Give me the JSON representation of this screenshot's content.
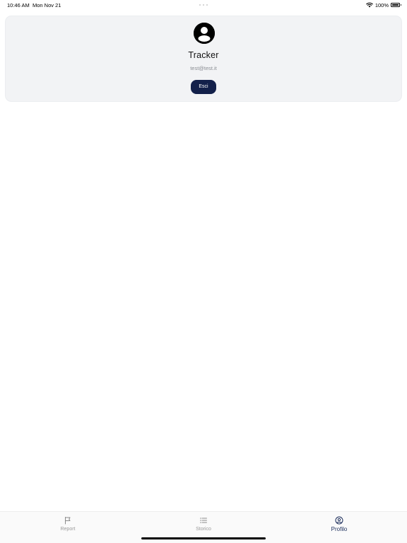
{
  "status_bar": {
    "time": "10:46 AM",
    "date": "Mon Nov 21",
    "battery": "100%",
    "battery_level": 1.0
  },
  "profile": {
    "avatar_icon": "user-circle-icon",
    "name": "Tracker",
    "email": "test@test.it",
    "logout_label": "Esci"
  },
  "tab_bar": {
    "tabs": [
      {
        "label": "Report",
        "icon": "flag-icon",
        "active": false
      },
      {
        "label": "Storico",
        "icon": "list-icon",
        "active": false
      },
      {
        "label": "Profilo",
        "icon": "user-circle-icon",
        "active": true
      }
    ]
  },
  "colors": {
    "accent": "#13204a",
    "active_tab": "#1b2d5b",
    "inactive_tab": "#9a9a9a",
    "card_background": "#f2f3f5"
  }
}
